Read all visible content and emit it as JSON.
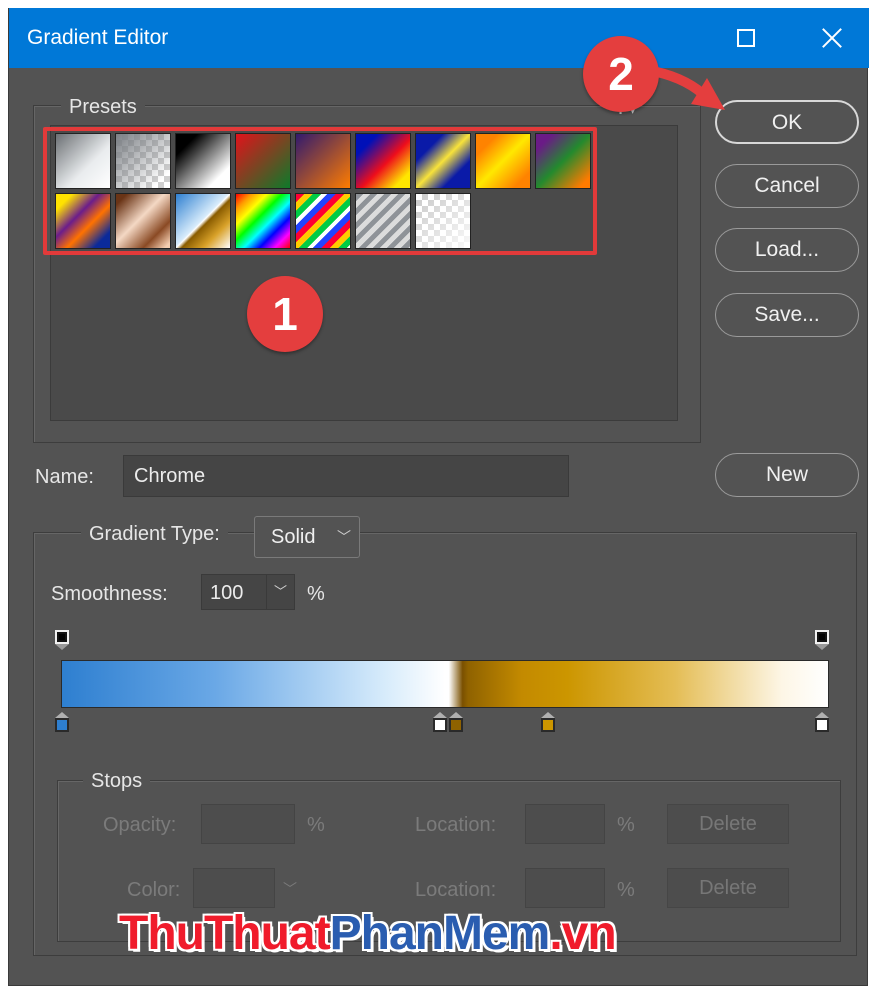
{
  "window": {
    "title": "Gradient Editor"
  },
  "presets": {
    "label": "Presets",
    "swatches": [
      {
        "name": "foreground-to-background",
        "css": "linear-gradient(135deg,#6b6f73,#e9ecee 60%,#ffffff)"
      },
      {
        "name": "foreground-to-transparent",
        "css": "linear-gradient(135deg,#7b7f84,rgba(255,255,255,0) 85%),repeating-conic-gradient(#cfcfcf 0 25%,#ffffff 0 50%) 0 0/12px 12px"
      },
      {
        "name": "black-white",
        "css": "linear-gradient(135deg,#000000 20%,#ffffff 80%)"
      },
      {
        "name": "red-green",
        "css": "linear-gradient(135deg,#e2121b,#0d7a2a)"
      },
      {
        "name": "violet-orange",
        "css": "linear-gradient(135deg,#311a6e,#ff7c00)"
      },
      {
        "name": "blue-red-yellow",
        "css": "linear-gradient(135deg,#0010b8 20%,#ee0d1b 55%,#ffe600 85%)"
      },
      {
        "name": "blue-yellow-blue",
        "css": "linear-gradient(135deg,#0a1aa8 25%,#f8e33a 50%,#0a1aa8 75%)"
      },
      {
        "name": "orange-yellow-orange",
        "css": "linear-gradient(135deg,#ff8300 20%,#ffe800 50%,#ff8300 85%)"
      },
      {
        "name": "violet-green-orange",
        "css": "linear-gradient(135deg,#6a1b86 15%,#238a2e 50%,#ff7b00 90%)"
      },
      {
        "name": "yellow-violet-orange-blue",
        "css": "linear-gradient(135deg,#ffe200 15%,#6b1d8b 40%,#ff7200 60%,#0b2a9a 85%)"
      },
      {
        "name": "copper",
        "css": "linear-gradient(135deg,#6a3416 10%,#f4d8c4 45%,#8a4a24 75%,#f4cdb0 95%)"
      },
      {
        "name": "chrome",
        "css": "linear-gradient(135deg,#2e7fd0 0%,#d8ecfb 48%,#ffffff 50%,#8a5c00 55%,#d9a22a 75%,#ffffff 100%)"
      },
      {
        "name": "spectrum",
        "css": "linear-gradient(135deg,#ff0000,#ff9900,#ffff00,#00ff00,#00ffff,#0000ff,#ff00ff,#ff0000)"
      },
      {
        "name": "transparent-rainbow",
        "css": "repeating-linear-gradient(135deg,#ff0033 0 6px,#ffcc00 6px 12px,#00cc44 12px 18px,#ffffff 18px 22px,#2244ff 22px 28px)"
      },
      {
        "name": "transparent-stripes",
        "css": "repeating-linear-gradient(135deg,#8f9398 0 5px,#dcdcdc 5px 10px)"
      },
      {
        "name": "neutral-density",
        "css": "linear-gradient(135deg,rgba(255,255,255,0),rgba(255,255,255,0.9)),repeating-conic-gradient(#c9c9c9 0 25%,#ffffff 0 50%) 0 0/12px 12px"
      }
    ]
  },
  "buttons": {
    "ok": "OK",
    "cancel": "Cancel",
    "load": "Load...",
    "save": "Save...",
    "new": "New"
  },
  "name": {
    "label": "Name:",
    "value": "Chrome"
  },
  "gradient": {
    "type_label": "Gradient Type:",
    "type_value": "Solid",
    "smoothness_label": "Smoothness:",
    "smoothness_value": "100",
    "smoothness_unit": "%"
  },
  "stops": {
    "label": "Stops",
    "opacity_label": "Opacity:",
    "opacity_unit": "%",
    "location_label": "Location:",
    "location_unit": "%",
    "delete_label": "Delete",
    "color_label": "Color:",
    "location2_label": "Location:",
    "location2_unit": "%",
    "delete2_label": "Delete"
  },
  "annotations": {
    "badge1": "1",
    "badge2": "2",
    "badge_color": "#e43e3e"
  },
  "watermark": {
    "part1": "ThuThuat",
    "part2": "PhanMem",
    "part3": ".vn"
  }
}
